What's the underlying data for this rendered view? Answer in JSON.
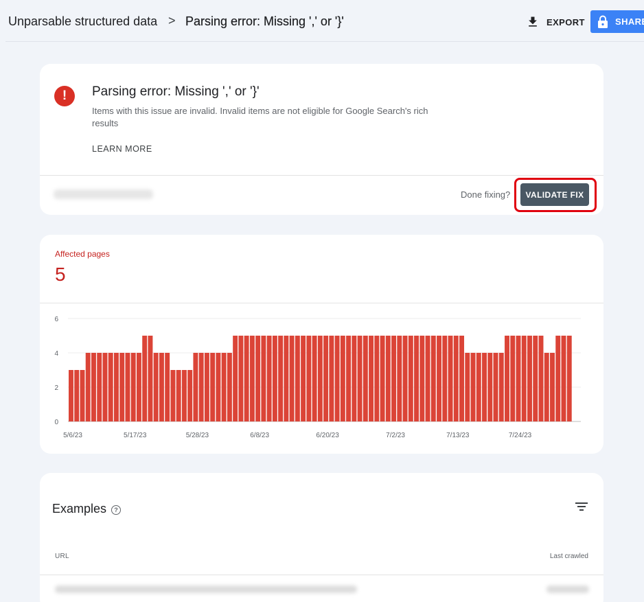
{
  "breadcrumb": {
    "parent": "Unparsable structured data",
    "separator": ">",
    "current": "Parsing error: Missing ',' or '}'"
  },
  "toolbar": {
    "export_label": "EXPORT",
    "share_label": "SHARE"
  },
  "issue": {
    "title": "Parsing error: Missing ',' or '}'",
    "description": "Items with this issue are invalid. Invalid items are not eligible for Google Search's rich results",
    "learn_more": "LEARN MORE",
    "done_fixing": "Done fixing?",
    "validate_label": "VALIDATE FIX"
  },
  "affected": {
    "label": "Affected pages",
    "value": "5"
  },
  "chart_data": {
    "type": "bar",
    "title": "",
    "xlabel": "",
    "ylabel": "",
    "ylim": [
      0,
      6
    ],
    "yticks": [
      0,
      2,
      4,
      6
    ],
    "grid": true,
    "legend": "none",
    "color": "#db4437",
    "x_tick_labels": [
      "5/6/23",
      "5/17/23",
      "5/28/23",
      "6/8/23",
      "6/20/23",
      "7/2/23",
      "7/13/23",
      "7/24/23"
    ],
    "x_tick_indices": [
      0,
      11,
      22,
      33,
      45,
      57,
      68,
      79
    ],
    "values": [
      3,
      3,
      3,
      4,
      4,
      4,
      4,
      4,
      4,
      4,
      4,
      4,
      4,
      5,
      5,
      4,
      4,
      4,
      3,
      3,
      3,
      3,
      4,
      4,
      4,
      4,
      4,
      4,
      4,
      5,
      5,
      5,
      5,
      5,
      5,
      5,
      5,
      5,
      5,
      5,
      5,
      5,
      5,
      5,
      5,
      5,
      5,
      5,
      5,
      5,
      5,
      5,
      5,
      5,
      5,
      5,
      5,
      5,
      5,
      5,
      5,
      5,
      5,
      5,
      5,
      5,
      5,
      5,
      5,
      5,
      4,
      4,
      4,
      4,
      4,
      4,
      4,
      5,
      5,
      5,
      5,
      5,
      5,
      5,
      4,
      4,
      5,
      5,
      5
    ]
  },
  "examples": {
    "title": "Examples",
    "col_url": "URL",
    "col_last_crawled": "Last crawled"
  }
}
